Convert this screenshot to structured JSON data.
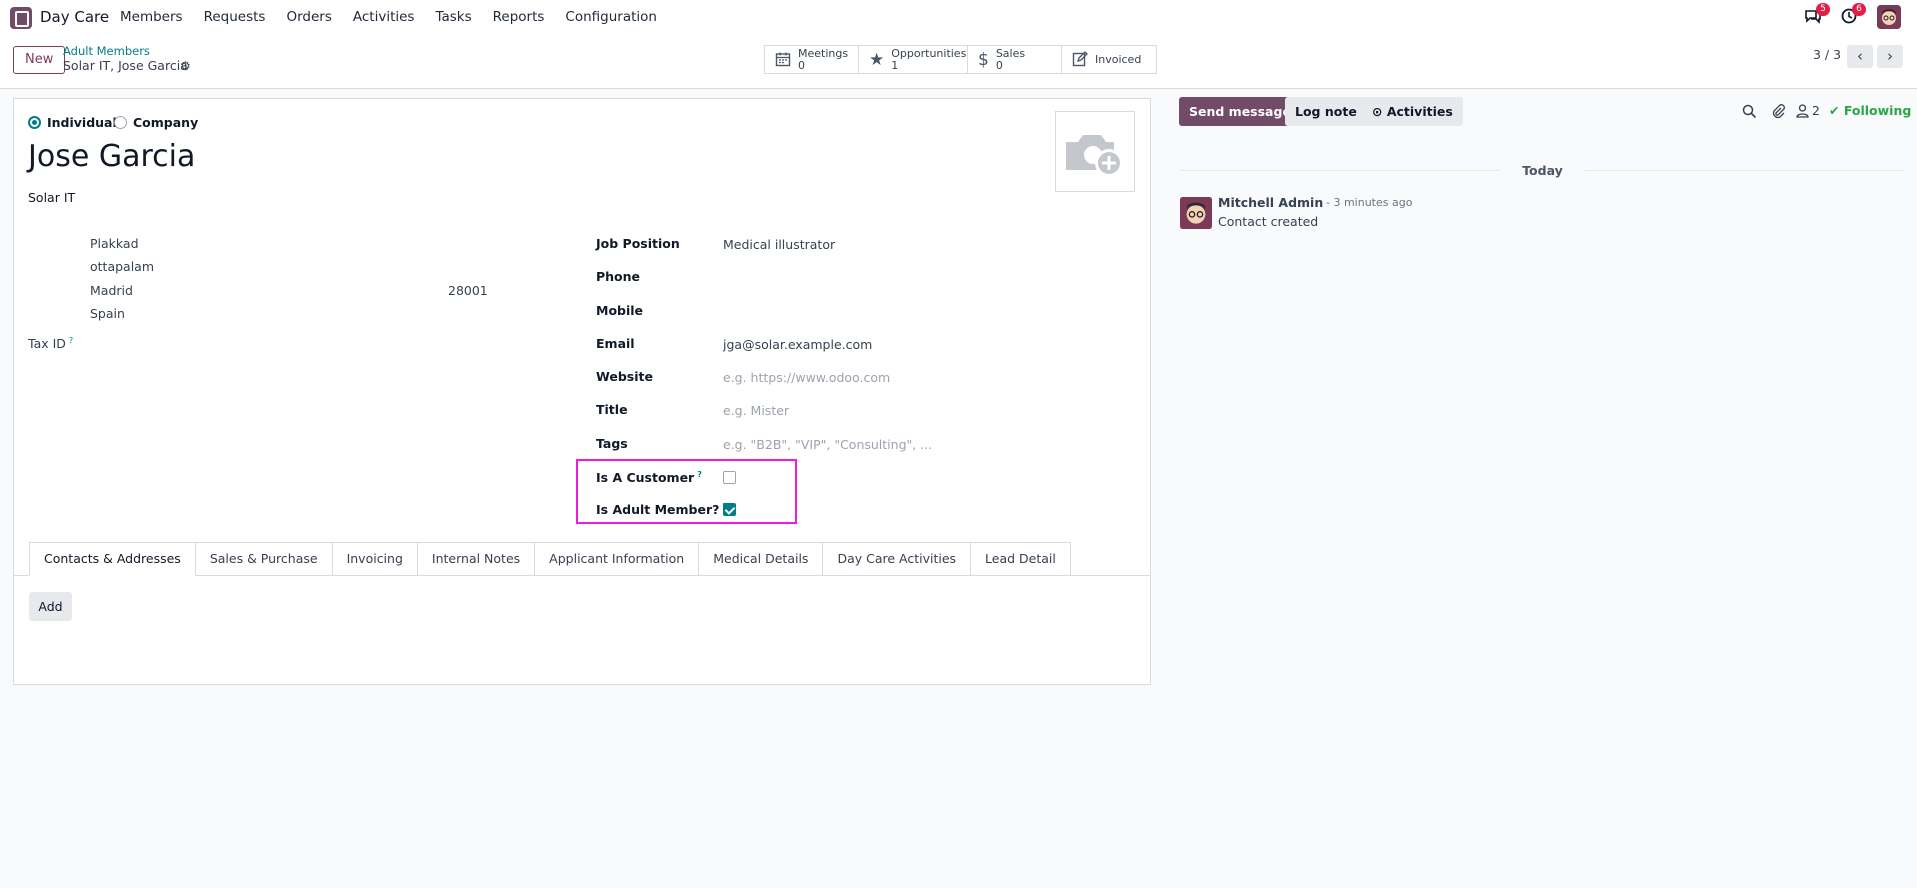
{
  "nav": {
    "app_name": "Day Care",
    "menu": [
      "Members",
      "Requests",
      "Orders",
      "Activities",
      "Tasks",
      "Reports",
      "Configuration"
    ],
    "messages_badge": "5",
    "activities_badge": "6",
    "icons": {
      "messages": "chat-icon",
      "activities": "clock-icon",
      "avatar": "user-avatar"
    }
  },
  "control_panel": {
    "new_label": "New",
    "breadcrumb_parent": "Adult Members",
    "breadcrumb_current": "Solar IT, Jose Garcia",
    "smart_buttons": [
      {
        "icon": "calendar-icon",
        "label": "Meetings",
        "value": "0"
      },
      {
        "icon": "star-icon",
        "label": "Opportunities",
        "value": "1"
      },
      {
        "icon": "dollar-icon",
        "label": "Sales",
        "value": "0"
      },
      {
        "icon": "invoice-icon",
        "label": "Invoiced",
        "value": ""
      }
    ],
    "pager": "3 / 3"
  },
  "form": {
    "type_individual": "Individual",
    "type_company": "Company",
    "selected_type": "Individual",
    "name": "Jose Garcia",
    "company": "Solar IT",
    "address": {
      "street": "Plakkad",
      "street2": "ottapalam",
      "city": "Madrid",
      "zip": "28001",
      "country": "Spain"
    },
    "tax_id_label": "Tax ID",
    "fields": {
      "job_position": {
        "label": "Job Position",
        "value": "Medical illustrator"
      },
      "phone": {
        "label": "Phone",
        "value": ""
      },
      "mobile": {
        "label": "Mobile",
        "value": ""
      },
      "email": {
        "label": "Email",
        "value": "jga@solar.example.com"
      },
      "website": {
        "label": "Website",
        "placeholder": "e.g. https://www.odoo.com"
      },
      "title": {
        "label": "Title",
        "placeholder": "e.g. Mister"
      },
      "tags": {
        "label": "Tags",
        "placeholder": "e.g. \"B2B\", \"VIP\", \"Consulting\", ..."
      },
      "is_customer": {
        "label": "Is A Customer",
        "checked": false
      },
      "is_adult_member": {
        "label": "Is Adult Member?",
        "checked": true
      }
    },
    "tooltip_mark": "?",
    "tabs": [
      "Contacts & Addresses",
      "Sales & Purchase",
      "Invoicing",
      "Internal Notes",
      "Applicant Information",
      "Medical Details",
      "Day Care Activities",
      "Lead Detail"
    ],
    "add_label": "Add"
  },
  "chatter": {
    "send_message": "Send message",
    "log_note": "Log note",
    "activities": "Activities",
    "followers_count": "2",
    "following": "Following",
    "day_separator": "Today",
    "messages": [
      {
        "author": "Mitchell Admin",
        "time": "- 3 minutes ago",
        "body": "Contact created"
      }
    ]
  },
  "colors": {
    "primary": "#714b67",
    "accent": "#017e84",
    "highlight": "#ee1ce0",
    "following": "#28a745"
  }
}
